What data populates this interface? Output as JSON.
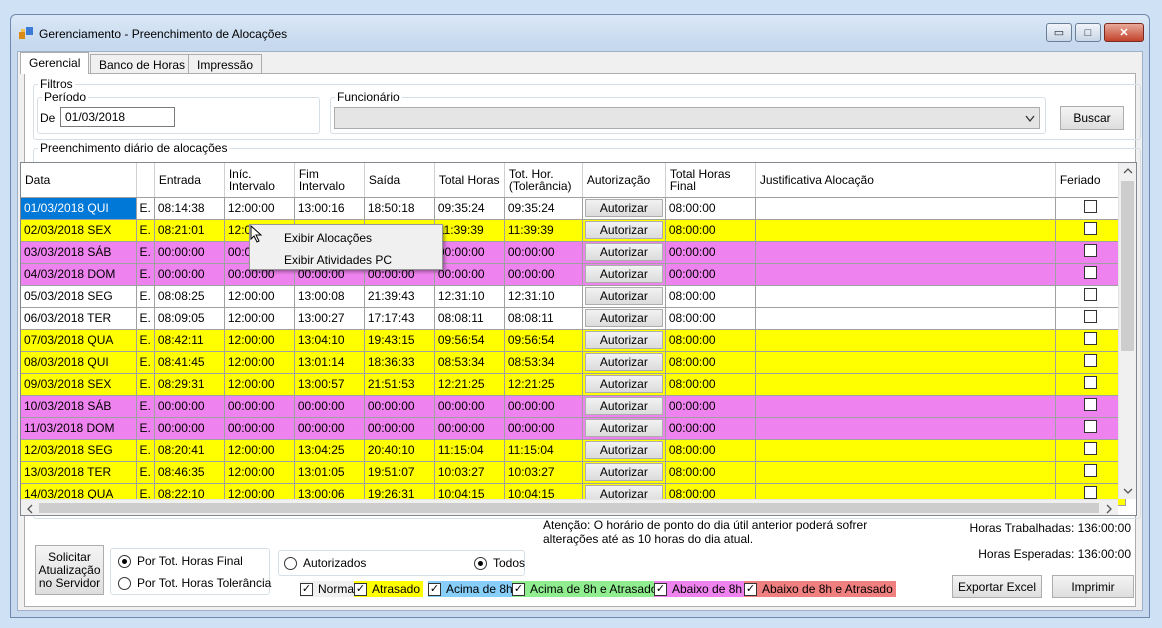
{
  "window": {
    "title": "Gerenciamento - Preenchimento de Alocações",
    "min": "▭",
    "max": "□",
    "close": "✕"
  },
  "tabs": [
    "Gerencial",
    "Banco de Horas",
    "Impressão"
  ],
  "filters": {
    "legend": "Filtros",
    "period_legend": "Período",
    "de_label": "De",
    "de_value": "01/03/2018",
    "employee_legend": "Funcionário",
    "employee_value": "",
    "search_label": "Buscar"
  },
  "grid": {
    "legend": "Preenchimento diário de alocações",
    "columns": [
      "Data",
      "",
      "Entrada",
      "Iníc. Intervalo",
      "Fim Intervalo",
      "Saída",
      "Total Horas",
      "Tot. Hor. (Tolerância)",
      "Autorização",
      "Total Horas Final",
      "Justificativa Alocação",
      "Feriado"
    ],
    "authorize_label": "Autorizar",
    "rows": [
      {
        "data": "01/03/2018 QUI",
        "e": "E.",
        "entrada": "08:14:38",
        "inicio": "12:00:00",
        "fim": "13:00:16",
        "saida": "18:50:18",
        "total": "09:35:24",
        "tol": "09:35:24",
        "final": "08:00:00",
        "color": "#ffffff"
      },
      {
        "data": "02/03/2018 SEX",
        "e": "E.",
        "entrada": "08:21:01",
        "inicio": "12:00:00",
        "fim": "13:01:12",
        "saida": "20:00:12",
        "total": "11:39:39",
        "tol": "11:39:39",
        "final": "08:00:00",
        "color": "#ffff00"
      },
      {
        "data": "03/03/2018 SÁB",
        "e": "E.",
        "entrada": "00:00:00",
        "inicio": "00:00:00",
        "fim": "00:00:00",
        "saida": "00:00:00",
        "total": "00:00:00",
        "tol": "00:00:00",
        "final": "00:00:00",
        "color": "#ee82ee"
      },
      {
        "data": "04/03/2018 DOM",
        "e": "E.",
        "entrada": "00:00:00",
        "inicio": "00:00:00",
        "fim": "00:00:00",
        "saida": "00:00:00",
        "total": "00:00:00",
        "tol": "00:00:00",
        "final": "00:00:00",
        "color": "#ee82ee"
      },
      {
        "data": "05/03/2018 SEG",
        "e": "E.",
        "entrada": "08:08:25",
        "inicio": "12:00:00",
        "fim": "13:00:08",
        "saida": "21:39:43",
        "total": "12:31:10",
        "tol": "12:31:10",
        "final": "08:00:00",
        "color": "#ffffff"
      },
      {
        "data": "06/03/2018 TER",
        "e": "E.",
        "entrada": "08:09:05",
        "inicio": "12:00:00",
        "fim": "13:00:27",
        "saida": "17:17:43",
        "total": "08:08:11",
        "tol": "08:08:11",
        "final": "08:00:00",
        "color": "#ffffff"
      },
      {
        "data": "07/03/2018 QUA",
        "e": "E.",
        "entrada": "08:42:11",
        "inicio": "12:00:00",
        "fim": "13:04:10",
        "saida": "19:43:15",
        "total": "09:56:54",
        "tol": "09:56:54",
        "final": "08:00:00",
        "color": "#ffff00"
      },
      {
        "data": "08/03/2018 QUI",
        "e": "E.",
        "entrada": "08:41:45",
        "inicio": "12:00:00",
        "fim": "13:01:14",
        "saida": "18:36:33",
        "total": "08:53:34",
        "tol": "08:53:34",
        "final": "08:00:00",
        "color": "#ffff00"
      },
      {
        "data": "09/03/2018 SEX",
        "e": "E.",
        "entrada": "08:29:31",
        "inicio": "12:00:00",
        "fim": "13:00:57",
        "saida": "21:51:53",
        "total": "12:21:25",
        "tol": "12:21:25",
        "final": "08:00:00",
        "color": "#ffff00"
      },
      {
        "data": "10/03/2018 SÁB",
        "e": "E.",
        "entrada": "00:00:00",
        "inicio": "00:00:00",
        "fim": "00:00:00",
        "saida": "00:00:00",
        "total": "00:00:00",
        "tol": "00:00:00",
        "final": "00:00:00",
        "color": "#ee82ee"
      },
      {
        "data": "11/03/2018 DOM",
        "e": "E.",
        "entrada": "00:00:00",
        "inicio": "00:00:00",
        "fim": "00:00:00",
        "saida": "00:00:00",
        "total": "00:00:00",
        "tol": "00:00:00",
        "final": "00:00:00",
        "color": "#ee82ee"
      },
      {
        "data": "12/03/2018 SEG",
        "e": "E.",
        "entrada": "08:20:41",
        "inicio": "12:00:00",
        "fim": "13:04:25",
        "saida": "20:40:10",
        "total": "11:15:04",
        "tol": "11:15:04",
        "final": "08:00:00",
        "color": "#ffff00"
      },
      {
        "data": "13/03/2018 TER",
        "e": "E.",
        "entrada": "08:46:35",
        "inicio": "12:00:00",
        "fim": "13:01:05",
        "saida": "19:51:07",
        "total": "10:03:27",
        "tol": "10:03:27",
        "final": "08:00:00",
        "color": "#ffff00"
      },
      {
        "data": "14/03/2018 QUA",
        "e": "E.",
        "entrada": "08:22:10",
        "inicio": "12:00:00",
        "fim": "13:00:06",
        "saida": "19:26:31",
        "total": "10:04:15",
        "tol": "10:04:15",
        "final": "08:00:00",
        "color": "#ffff00"
      }
    ]
  },
  "context_menu": [
    "Exibir Alocações",
    "Exibir Atividades PC"
  ],
  "footer": {
    "notice": "Atenção: O horário de ponto do dia útil anterior poderá sofrer alterações até as 10 horas do dia atual.",
    "worked_hours": "Horas Trabalhadas: 136:00:00",
    "expected_hours": "Horas Esperadas: 136:00:00",
    "request_update": "Solicitar Atualização no Servidor",
    "radio_final": "Por Tot. Horas Final",
    "radio_tolerance": "Por Tot. Horas Tolerância",
    "radio_authorized": "Autorizados",
    "radio_all": "Todos",
    "legend_items": [
      {
        "label": "Normal",
        "color": "#f0f0f0"
      },
      {
        "label": "Atrasado",
        "color": "#ffff00"
      },
      {
        "label": "Acima de 8h",
        "color": "#87cefa"
      },
      {
        "label": "Acima de 8h e Atrasado",
        "color": "#90ee90"
      },
      {
        "label": "Abaixo de 8h",
        "color": "#ee82ee"
      },
      {
        "label": "Abaixo de 8h e Atrasado",
        "color": "#f08080"
      }
    ],
    "export_excel": "Exportar Excel",
    "print": "Imprimir"
  }
}
